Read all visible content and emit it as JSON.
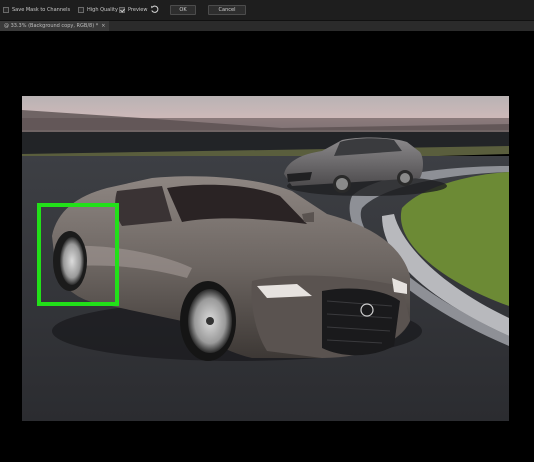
{
  "options_bar": {
    "save_mask_label": "Save Mask to Channels",
    "high_quality_label": "High Quality",
    "preview_label": "Preview",
    "ok_label": "OK",
    "cancel_label": "Cancel",
    "preview_checked": true,
    "reset_icon": "undo-icon"
  },
  "document_tab": {
    "title": "@ 33.3% (Background copy, RGB/8) *",
    "close_icon": "close-icon"
  },
  "canvas": {
    "selection_color": "#22e019"
  }
}
